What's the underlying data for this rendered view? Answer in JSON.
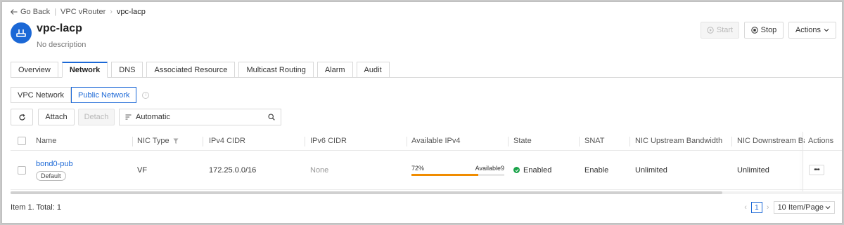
{
  "breadcrumb": {
    "back": "Go Back",
    "parent": "VPC vRouter",
    "current": "vpc-lacp"
  },
  "header": {
    "title": "vpc-lacp",
    "description": "No description",
    "start_label": "Start",
    "stop_label": "Stop",
    "actions_label": "Actions"
  },
  "tabs": [
    "Overview",
    "Network",
    "DNS",
    "Associated Resource",
    "Multicast Routing",
    "Alarm",
    "Audit"
  ],
  "active_tab": "Network",
  "network_view": {
    "options": [
      "VPC Network",
      "Public Network"
    ],
    "selected": "Public Network"
  },
  "toolbar": {
    "attach_label": "Attach",
    "detach_label": "Detach",
    "filter_value": "Automatic"
  },
  "table": {
    "columns": [
      "Name",
      "NIC Type",
      "IPv4 CIDR",
      "IPv6 CIDR",
      "Available IPv4",
      "State",
      "SNAT",
      "NIC Upstream Bandwidth",
      "NIC Downstream Ban",
      "Actions"
    ],
    "rows": [
      {
        "name": "bond0-pub",
        "badge": "Default",
        "nic_type": "VF",
        "ipv4_cidr": "172.25.0.0/16",
        "ipv6_cidr": "None",
        "available_pct_label": "72%",
        "available_count_label": "Available9",
        "available_fraction": 0.72,
        "state": "Enabled",
        "snat": "Enable",
        "upstream": "Unlimited",
        "downstream": "Unlimited"
      }
    ]
  },
  "footer": {
    "total": "Item 1. Total: 1",
    "page": "1",
    "page_size": "10 Item/Page"
  },
  "colors": {
    "accent": "#1b68d6",
    "progress": "#f08c00",
    "enabled": "#1aa34a"
  }
}
